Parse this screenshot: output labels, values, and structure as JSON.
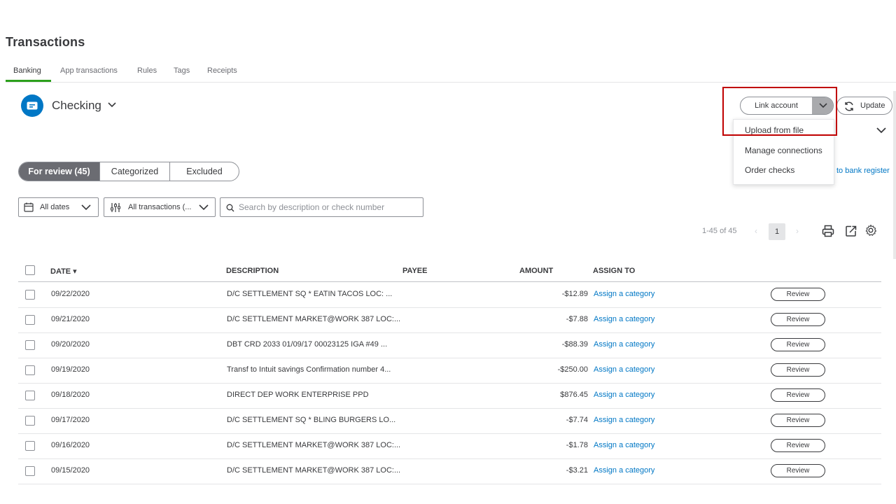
{
  "page": {
    "title": "Transactions"
  },
  "tabs": [
    "Banking",
    "App transactions",
    "Rules",
    "Tags",
    "Receipts"
  ],
  "account": {
    "name": "Checking"
  },
  "buttons": {
    "link_account": "Link account",
    "update": "Update"
  },
  "link_menu": [
    "Upload from file",
    "Manage connections",
    "Order checks"
  ],
  "register_link": "to bank register",
  "segments": [
    "For review (45)",
    "Categorized",
    "Excluded"
  ],
  "filters": {
    "dates": "All dates",
    "transactions": "All transactions (...",
    "search_placeholder": "Search by description or check number"
  },
  "pagination": {
    "range": "1-45 of 45",
    "prev": "‹",
    "current": "1",
    "next": "›"
  },
  "table": {
    "headers": {
      "date": "DATE ▾",
      "description": "DESCRIPTION",
      "payee": "PAYEE",
      "amount": "AMOUNT",
      "assign_to": "ASSIGN TO"
    },
    "rows": [
      {
        "date": "09/22/2020",
        "description": "D/C SETTLEMENT  SQ * EATIN TACOS LOC: ...",
        "amount": "-$12.89",
        "assign": "Assign a category",
        "action": "Review"
      },
      {
        "date": "09/21/2020",
        "description": "D/C SETTLEMENT MARKET@WORK 387 LOC:...",
        "amount": "-$7.88",
        "assign": "Assign a category",
        "action": "Review"
      },
      {
        "date": "09/20/2020",
        "description": "DBT CRD 2033 01/09/17 00023125 IGA #49 ...",
        "amount": "-$88.39",
        "assign": "Assign a category",
        "action": "Review"
      },
      {
        "date": "09/19/2020",
        "description": "Transf to Intuit savings Confirmation number 4...",
        "amount": "-$250.00",
        "assign": "Assign a category",
        "action": "Review"
      },
      {
        "date": "09/18/2020",
        "description": "DIRECT DEP WORK ENTERPRISE PPD",
        "amount": "$876.45",
        "assign": "Assign a category",
        "action": "Review"
      },
      {
        "date": "09/17/2020",
        "description": "D/C SETTLEMENT  SQ * BLING BURGERS LO...",
        "amount": "-$7.74",
        "assign": "Assign a category",
        "action": "Review"
      },
      {
        "date": "09/16/2020",
        "description": "D/C SETTLEMENT MARKET@WORK 387 LOC:...",
        "amount": "-$1.78",
        "assign": "Assign a category",
        "action": "Review"
      },
      {
        "date": "09/15/2020",
        "description": "D/C SETTLEMENT MARKET@WORK 387 LOC:...",
        "amount": "-$3.21",
        "assign": "Assign a category",
        "action": "Review"
      }
    ]
  },
  "colors": {
    "accent_green": "#2ca01c",
    "link_blue": "#0077c5",
    "highlight_red": "#c00000"
  },
  "icons": [
    "bank-card-icon",
    "chevron-down-icon",
    "refresh-icon",
    "calendar-icon",
    "filter-sliders-icon",
    "search-icon",
    "print-icon",
    "export-icon",
    "gear-icon"
  ]
}
